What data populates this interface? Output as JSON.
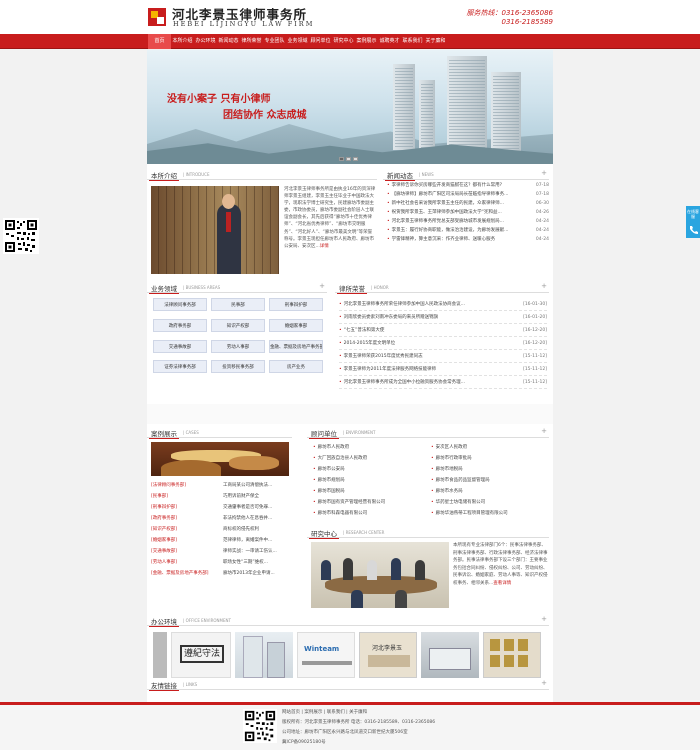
{
  "header": {
    "logo_cn": "河北李景玉律师事务所",
    "logo_en": "HEBEI LIJINGYU LAW FIRM",
    "hotline_label": "服务热线：",
    "hotline_1": "0316-2365086",
    "hotline_2": "0316-2185589"
  },
  "nav": [
    "首页",
    "本所介绍",
    "办公环境",
    "新闻动态",
    "律所荣誉",
    "专业团队",
    "业务领域",
    "顾问单位",
    "研究中心",
    "案例展示",
    "诚聘英才",
    "联系我们",
    "关于廉和"
  ],
  "banner": {
    "line1": "没有小案子  只有小律师",
    "line2": "团结协作  众志成城"
  },
  "intro": {
    "title": "本所介绍",
    "en": "| INTRODUCE",
    "text": "河北李景玉律师事务所是由执业16年的资深律师李景玉组建，李景玉主任毕业于中国政法大学，现职法学博士研究生，民建廊坊市委副主委，市政协委员，廊坊市委副社会阶层人士联谊会副会长，其先后获得“廊坊市十佳优秀律师”、“河北省优秀律师”、“廊坊市交明服务”、“河北好人”、“廊坊市最美文明”等荣誉称号。李景玉现担任廊坊市人民政府、廊坊市公安局、安次区...",
    "more": "详情"
  },
  "news": {
    "title": "新闻动态",
    "en": "| NEWS",
    "items": [
      {
        "text": "李律师告诉你买房哪些开发商猫腻在这？都有什么常用?",
        "date": "07-18"
      },
      {
        "text": "【廊坊律师】廊坊市广阳区司法局局长莅临指导律师事务...",
        "date": "07-18"
      },
      {
        "text": "新中社社会名采访我所李景玉主任的民建，众家律律师...",
        "date": "06-30"
      },
      {
        "text": "祝贺我所李景玉、王萍律师参加中国政法大学“宪和益...",
        "date": "04-26"
      },
      {
        "text": "河北李景玉律师事务所党总支部受廊坊城市发展规划局...",
        "date": "04-24"
      },
      {
        "text": "李景玉：履行好协商职能，做法治治建设，为廊坊发展献...",
        "date": "04-24"
      },
      {
        "text": "学雷锋精神，算主意沉采：作齐业律师、送暖心服务",
        "date": "04-24"
      }
    ]
  },
  "business": {
    "title": "业务领域",
    "en": "| BUSINESS AREAS",
    "items": [
      "法律顾问事务部",
      "民事部",
      "刑事辩护部",
      "政府事务部",
      "知识产权部",
      "婚姻家事部",
      "交通事故部",
      "劳动人事部",
      "金融、票据及房地产事务部",
      "证券法律事务部",
      "投资移民事务部",
      "房产业务"
    ]
  },
  "honor": {
    "title": "律所荣誉",
    "en": "| HONOR",
    "items": [
      {
        "text": "河北李景玉律师事务所荣任律师参加中国人民政法协商会议...",
        "date": "[16-01-30]"
      },
      {
        "text": "刘雨欣委员委索刘南冲东委局的来员所赠送锦旗",
        "date": "[16-01-20]"
      },
      {
        "text": "“七五”普法和第大使",
        "date": "[16-12-20]"
      },
      {
        "text": "2014-2015年度文明单位",
        "date": "[16-12-20]"
      },
      {
        "text": "李景玉律师荣获2015年度优秀民建同志",
        "date": "[15-11-12]"
      },
      {
        "text": "李景玉律师为2011年度法律服务网络技能律师",
        "date": "[15-11-12]"
      },
      {
        "text": "河北李景玉律师事务所成为全国中小拉融资服务协会常务理...",
        "date": "[15-11-12]"
      }
    ]
  },
  "cases": {
    "title": "案例展示",
    "en": "| CASES",
    "items": [
      {
        "tag": "[法律顾问事务部]",
        "text": "工商局某公司清偿执法..."
      },
      {
        "tag": "[民事部]",
        "text": "巧用诉前财产保全"
      },
      {
        "tag": "[刑事辩护部]",
        "text": "交通肇事者是否可免罪..."
      },
      {
        "tag": "[政府事务部]",
        "text": "非法拘禁他人在息吞并..."
      },
      {
        "tag": "[知识产权部]",
        "text": "商标权的侵先权利"
      },
      {
        "tag": "[婚姻家事部]",
        "text": "范律律师，离婚案件中..."
      },
      {
        "tag": "[交通事故部]",
        "text": "律师实战：一审请工伤认..."
      },
      {
        "tag": "[劳动人事部]",
        "text": "职场女性“三期”维权..."
      },
      {
        "tag": "[金融、票据及房地产事务部]",
        "text": "廊坊市2013年企业申请..."
      }
    ]
  },
  "clients": {
    "title": "顾问单位",
    "en": "| ENVIRONMENT",
    "left": [
      "廊坊市人民政府",
      "大厂回族自治县人民政府",
      "廊坊市公安局",
      "廊坊市规划局",
      "廊坊市国税局",
      "廊坊市国有资产管理经营有限公司",
      "廊坊市科森电器有限公司"
    ],
    "right": [
      "安次区人民政府",
      "廊坊市行政审批局",
      "廊坊市地税局",
      "廊坊市食品药品监督管理局",
      "廊坊市水务局",
      "华药星士坊电储有限公司",
      "廊坊华油燕蒂工程项目管理有限公司"
    ]
  },
  "research": {
    "title": "研究中心",
    "en": "| RESEARCH CENTER",
    "text": "本所现有专业法律部门6个：民事法律事务部、刑事法律事务部、行政法律事务部、经济法律事务部。民事法律事务部下设三个部门：王要事业务包括合同纠纷、侵权纠纷、公司、劳动纠纷、民事诉讼、婚姻家庭、劳动人事等、知识产权侵权事务、相邻关系...",
    "more": "查看详情"
  },
  "office": {
    "title": "办公环境",
    "en": "| OFFICE ENVIRONMENT",
    "sign1": "遵紀守法",
    "sign2": "Winteam",
    "sign3": "河北李景玉"
  },
  "links": {
    "title": "友情链接",
    "en": "| LINKS"
  },
  "footer": {
    "links": "网站首页 | 案例展示 | 联系我们 | 关于廉和",
    "line1": "版权所有：河北李景玉律师事务所  电话：0316-2185589、0316-2365086",
    "line2": "公司地址：廊坊市广阳区永兴路与北凤道交口新世纪大厦506室",
    "line3": "冀ICP备09025180号"
  },
  "side": {
    "tab": "在线客服"
  },
  "colors": {
    "brand": "#c81d1d",
    "accent_blue": "#2aa5e0"
  }
}
